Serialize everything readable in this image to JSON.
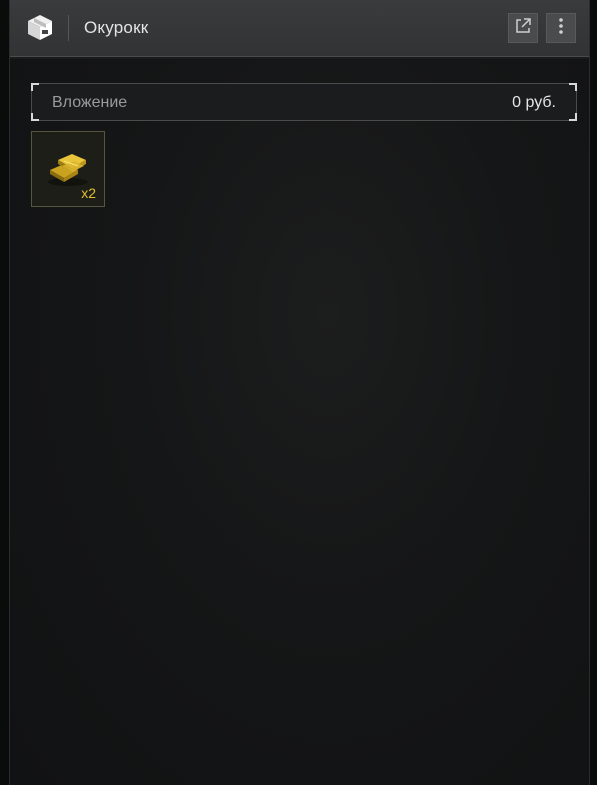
{
  "window": {
    "title": "Окурокк",
    "icon": "package-icon",
    "buttons": [
      {
        "name": "popout",
        "icon": "external-link-icon"
      },
      {
        "name": "menu",
        "icon": "kebab-menu-icon"
      }
    ]
  },
  "value_bar": {
    "label": "Вложение",
    "amount": "0 руб."
  },
  "items": [
    {
      "icon": "gold-bars-icon",
      "count": "x2",
      "color": "#e0c030"
    }
  ]
}
